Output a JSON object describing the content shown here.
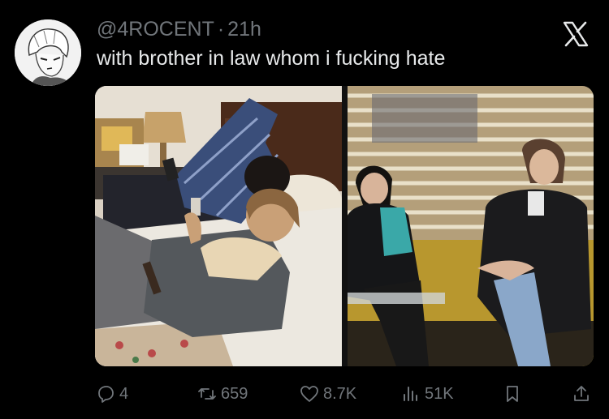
{
  "tweet": {
    "handle": "@4ROCENT",
    "separator": "·",
    "time": "21h",
    "text": "with brother in law whom i fucking hate"
  },
  "icons": {
    "avatar": "anime-portrait",
    "logo": "x-logo",
    "reply": "reply-icon",
    "retweet": "retweet-icon",
    "like": "heart-icon",
    "views": "views-icon",
    "bookmark": "bookmark-icon",
    "share": "share-icon"
  },
  "actions": {
    "replies": "4",
    "retweets": "659",
    "likes": "8.7K",
    "views": "51K"
  },
  "colors": {
    "background": "#000000",
    "text": "#e7e9ea",
    "muted": "#71767b"
  }
}
